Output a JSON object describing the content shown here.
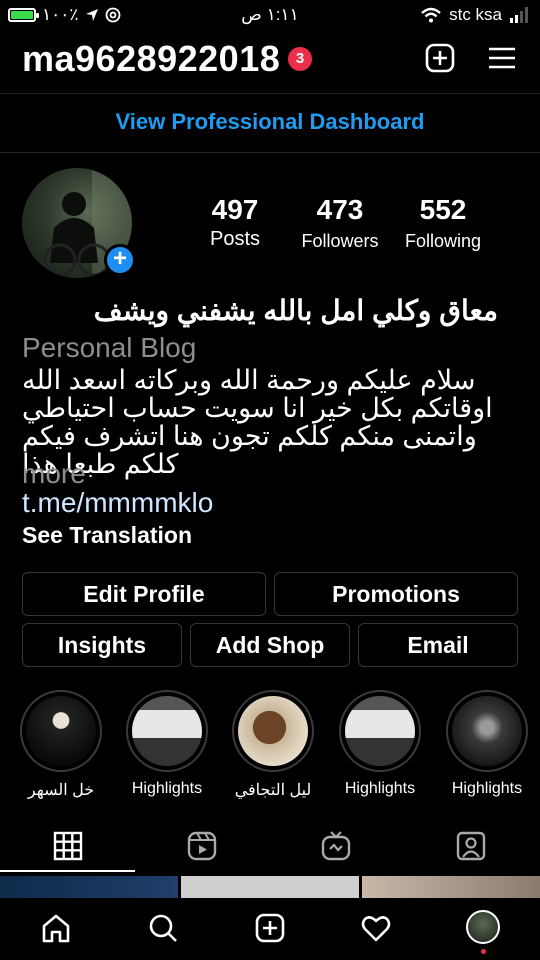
{
  "status_bar": {
    "battery_text": "١٠٠٪",
    "battery_level": 1.0,
    "time": "١:١١ ص",
    "carrier": "stc ksa"
  },
  "header": {
    "username": "ma9628922018",
    "notification_count": "3",
    "new_post_icon": "plus-square-icon",
    "menu_icon": "hamburger-menu-icon"
  },
  "pro_dashboard": {
    "label": "View Professional Dashboard",
    "color": "#1f9bf0"
  },
  "stats": {
    "posts": {
      "value": "497",
      "label": "Posts"
    },
    "followers": {
      "value": "473",
      "label": "Followers"
    },
    "following": {
      "value": "552",
      "label": "Following"
    }
  },
  "bio": {
    "name": "معاق وكلي امل بالله يشفني ويشف",
    "category": "Personal Blog",
    "text": "سلام عليكم ورحمة الله وبركاته اسعد الله اوقاتكم بكل خير انا سويت حساب احتياطي واتمنى منكم كلكم تجون هنا اتشرف فيكم كلكم طبعا هذا",
    "more": "more",
    "link": "t.me/mmmmklo",
    "see_translation": "See Translation"
  },
  "buttons": {
    "edit_profile": "Edit Profile",
    "promotions": "Promotions",
    "insights": "Insights",
    "add_shop": "Add Shop",
    "email": "Email"
  },
  "highlights": [
    {
      "caption": "خل السهر"
    },
    {
      "caption": "Highlights"
    },
    {
      "caption": "ليل التجافي"
    },
    {
      "caption": "Highlights"
    },
    {
      "caption": "Highlights"
    }
  ],
  "tabs": [
    "grid-icon",
    "reels-icon",
    "igtv-icon",
    "tagged-icon"
  ],
  "bottom_nav": [
    "home-icon",
    "search-icon",
    "create-icon",
    "heart-icon",
    "profile-avatar"
  ],
  "colors": {
    "accent": "#1f9bf0",
    "badge": "#ed2e4b",
    "button_border": "#363636",
    "muted": "#8e8e8e"
  }
}
